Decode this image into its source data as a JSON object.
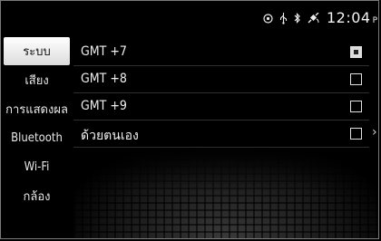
{
  "statusbar": {
    "icons": [
      "circle-target-icon",
      "usb-icon",
      "bluetooth-icon",
      "satellite-icon"
    ],
    "time": "12:04",
    "ampm": "PM"
  },
  "sidebar": {
    "items": [
      {
        "label": "ระบบ",
        "active": true
      },
      {
        "label": "เสียง",
        "active": false
      },
      {
        "label": "การแสดงผล",
        "active": false
      },
      {
        "label": "Bluetooth",
        "active": false
      },
      {
        "label": "Wi-Fi",
        "active": false
      },
      {
        "label": "กล้อง",
        "active": false
      }
    ]
  },
  "timezone_list": {
    "rows": [
      {
        "label": "GMT +7",
        "selected": true,
        "has_submenu": false
      },
      {
        "label": "GMT +8",
        "selected": false,
        "has_submenu": false
      },
      {
        "label": "GMT +9",
        "selected": false,
        "has_submenu": false
      },
      {
        "label": "ด้วยตนเอง",
        "selected": false,
        "has_submenu": true
      }
    ]
  },
  "colors": {
    "background": "#000000",
    "active_tab": "#f0f0f0",
    "text": "#f2f2f2"
  }
}
